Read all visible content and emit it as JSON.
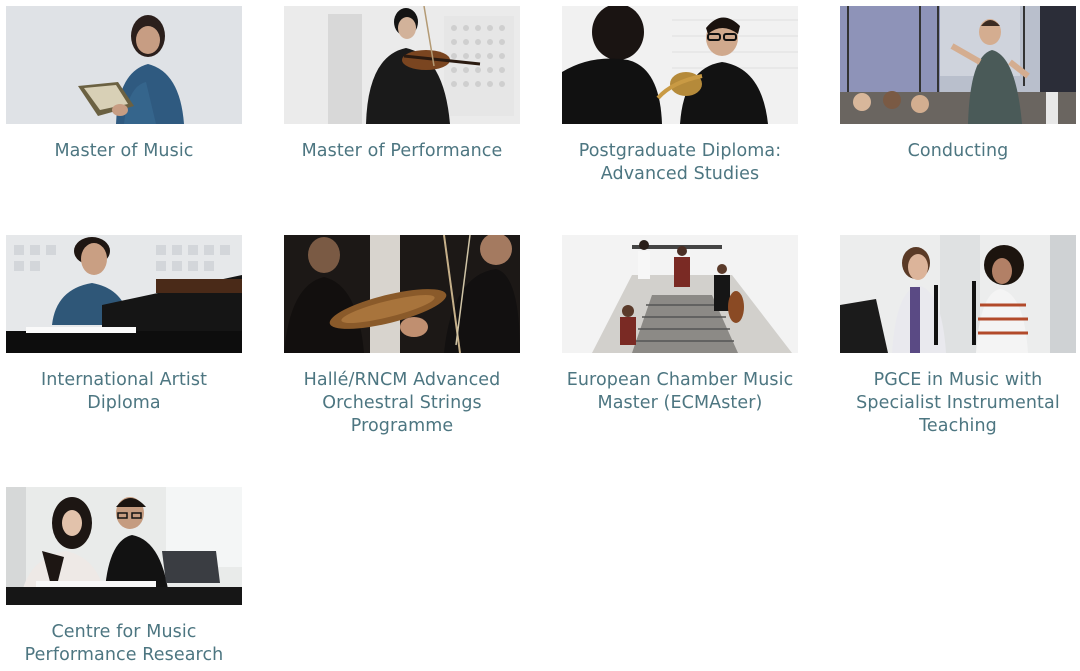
{
  "programmes": [
    {
      "label": "Master of Music",
      "image": "singer-holding-score-photo"
    },
    {
      "label": "Master of Performance",
      "image": "violinist-performing-photo"
    },
    {
      "label": "Postgraduate Diploma: Advanced Studies",
      "image": "horn-player-photo"
    },
    {
      "label": "Conducting",
      "image": "conductor-rehearsal-photo"
    },
    {
      "label": "International Artist Diploma",
      "image": "pianist-at-piano-photo"
    },
    {
      "label": "Hallé/RNCM Advanced Orchestral Strings Programme",
      "image": "violin-closeup-photo"
    },
    {
      "label": "European Chamber Music Master (ECMAster)",
      "image": "chamber-ensemble-staircase-photo"
    },
    {
      "label": "PGCE in Music with Specialist Instrumental Teaching",
      "image": "clarinet-teaching-photo"
    },
    {
      "label": "Centre for Music Performance Research",
      "image": "researchers-with-laptop-photo"
    }
  ]
}
